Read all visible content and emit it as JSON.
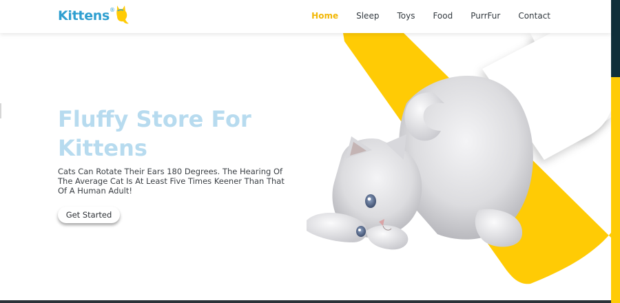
{
  "brand": {
    "name": "Kittens",
    "mark": "®",
    "icon": "cat-logo-icon"
  },
  "nav": {
    "items": [
      {
        "label": "Home",
        "active": true
      },
      {
        "label": "Sleep",
        "active": false
      },
      {
        "label": "Toys",
        "active": false
      },
      {
        "label": "Food",
        "active": false
      },
      {
        "label": "PurrFur",
        "active": false
      },
      {
        "label": "Contact",
        "active": false
      }
    ]
  },
  "hero": {
    "title": "Fluffy Store For Kittens",
    "text": "Cats Can Rotate Their Ears 180 Degrees. The Hearing Of The Average Cat Is At Least Five Times Keener Than That Of A Human Adult!",
    "cta_label": "Get Started",
    "image": "kitten-illustration"
  },
  "colors": {
    "accent": "#ffcb05",
    "brand_blue": "#2f9fd0",
    "title_blue": "#b7dbef",
    "active_nav": "#f2b705",
    "dark_edge": "#0f2f3a"
  }
}
